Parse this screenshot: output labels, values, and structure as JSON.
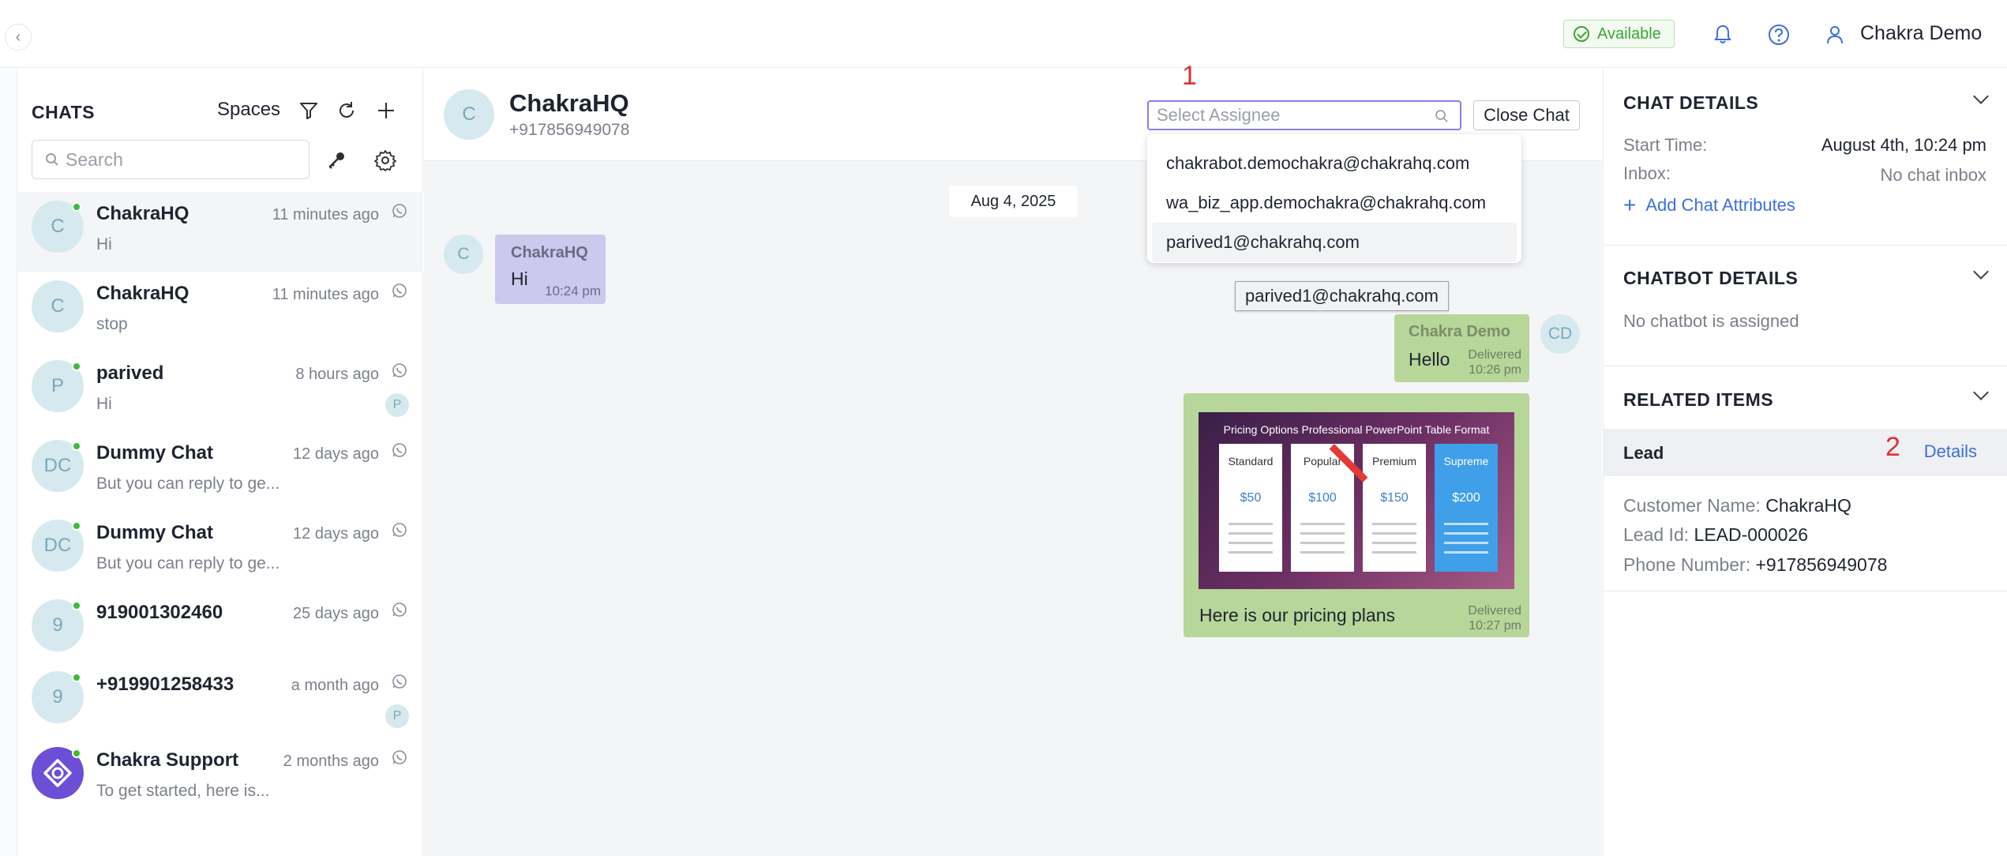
{
  "topbar": {
    "status_label": "Available",
    "user_name": "Chakra Demo"
  },
  "chats_panel": {
    "title": "CHATS",
    "spaces_label": "Spaces",
    "search_placeholder": "Search",
    "items": [
      {
        "initials": "C",
        "name": "ChakraHQ",
        "time": "11 minutes ago",
        "preview": "Hi",
        "online": true,
        "badge": ""
      },
      {
        "initials": "C",
        "name": "ChakraHQ",
        "time": "11 minutes ago",
        "preview": "stop",
        "online": false,
        "badge": ""
      },
      {
        "initials": "P",
        "name": "parived",
        "time": "8 hours ago",
        "preview": "Hi",
        "online": true,
        "badge": "P"
      },
      {
        "initials": "DC",
        "name": "Dummy Chat",
        "time": "12 days ago",
        "preview": "But you can reply to ge...",
        "online": true,
        "badge": ""
      },
      {
        "initials": "DC",
        "name": "Dummy Chat",
        "time": "12 days ago",
        "preview": "But you can reply to ge...",
        "online": true,
        "badge": ""
      },
      {
        "initials": "9",
        "name": "919001302460",
        "time": "25 days ago",
        "preview": "",
        "online": true,
        "badge": ""
      },
      {
        "initials": "9",
        "name": "+919901258433",
        "time": "a month ago",
        "preview": "",
        "online": true,
        "badge": "P"
      },
      {
        "initials": "",
        "name": "Chakra Support",
        "time": "2 months ago",
        "preview": "To get started, here is...",
        "online": true,
        "badge": ""
      }
    ]
  },
  "conversation": {
    "avatar_initial": "C",
    "name": "ChakraHQ",
    "phone": "+917856949078",
    "assignee_placeholder": "Select Assignee",
    "close_label": "Close Chat",
    "annotation_1": "1",
    "assignee_options": [
      "chakrabot.demochakra@chakrahq.com",
      "wa_biz_app.demochakra@chakrahq.com",
      "parived1@chakrahq.com"
    ],
    "tooltip": "parived1@chakrahq.com",
    "date_chip": "Aug 4, 2025",
    "messages": {
      "incoming": {
        "avatar": "C",
        "sender": "ChakraHQ",
        "text": "Hi",
        "time": "10:24 pm"
      },
      "outgoing": {
        "avatar": "CD",
        "sender": "Chakra Demo",
        "text": "Hello",
        "status": "Delivered",
        "time": "10:26 pm"
      },
      "image": {
        "caption": "Here is our pricing plans",
        "status": "Delivered",
        "time": "10:27 pm",
        "image_title": "Pricing Options Professional PowerPoint Table Format",
        "plans": [
          {
            "name": "Standard",
            "price": "$50"
          },
          {
            "name": "Popular",
            "price": "$100"
          },
          {
            "name": "Premium",
            "price": "$150"
          },
          {
            "name": "Supreme",
            "price": "$200"
          }
        ]
      }
    }
  },
  "details_panel": {
    "chat_details_title": "CHAT DETAILS",
    "start_time_label": "Start Time:",
    "start_time_value": "August 4th, 10:24 pm",
    "inbox_label": "Inbox:",
    "inbox_value": "No chat inbox",
    "add_attributes": "Add Chat Attributes",
    "chatbot_title": "CHATBOT DETAILS",
    "chatbot_value": "No chatbot is assigned",
    "related_title": "RELATED ITEMS",
    "lead_label": "Lead",
    "annotation_2": "2",
    "details_link": "Details",
    "customer_name_label": "Customer Name:",
    "customer_name": "ChakraHQ",
    "lead_id_label": "Lead Id:",
    "lead_id": "LEAD-000026",
    "phone_label": "Phone Number:",
    "phone": "+917856949078"
  },
  "colors": {
    "accent": "#3d6fd8",
    "online": "#3dbb3a",
    "outgoing_bubble": "#b7d69a",
    "incoming_bubble": "#cdc8ee",
    "annotation": "#e03131"
  }
}
